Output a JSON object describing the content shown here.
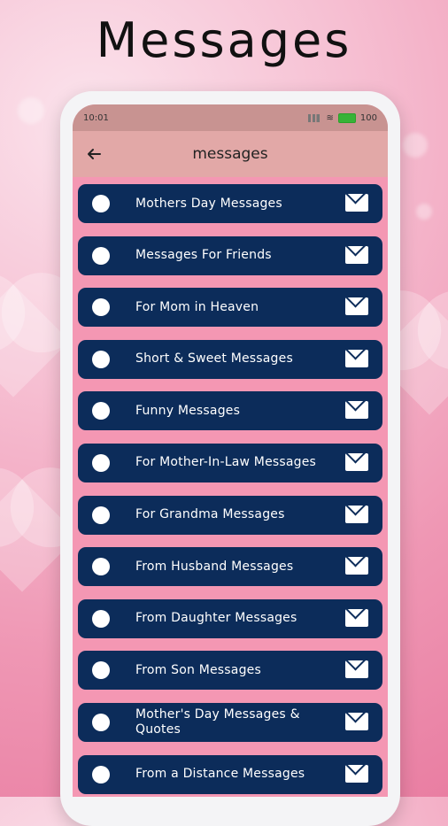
{
  "banner": {
    "title": "Messages"
  },
  "status_bar": {
    "time": "10:01",
    "battery": "100"
  },
  "app_bar": {
    "title": "messages"
  },
  "items": [
    {
      "label": "Mothers Day Messages"
    },
    {
      "label": "Messages For Friends"
    },
    {
      "label": "For Mom in Heaven"
    },
    {
      "label": "Short & Sweet Messages"
    },
    {
      "label": "Funny Messages"
    },
    {
      "label": "For Mother-In-Law Messages"
    },
    {
      "label": "For Grandma Messages"
    },
    {
      "label": "From Husband Messages"
    },
    {
      "label": "From Daughter Messages"
    },
    {
      "label": "From Son Messages"
    },
    {
      "label": "Mother's Day Messages & Quotes"
    },
    {
      "label": "From a Distance Messages"
    }
  ],
  "icons": {
    "back": "arrow-back-icon",
    "radio": "radio-icon",
    "mail": "mail-icon"
  },
  "colors": {
    "item_bg": "#0c2c5a",
    "screen_bg": "#f497b3",
    "app_bar": "#e2a8a7",
    "status_bar": "#c89391"
  }
}
